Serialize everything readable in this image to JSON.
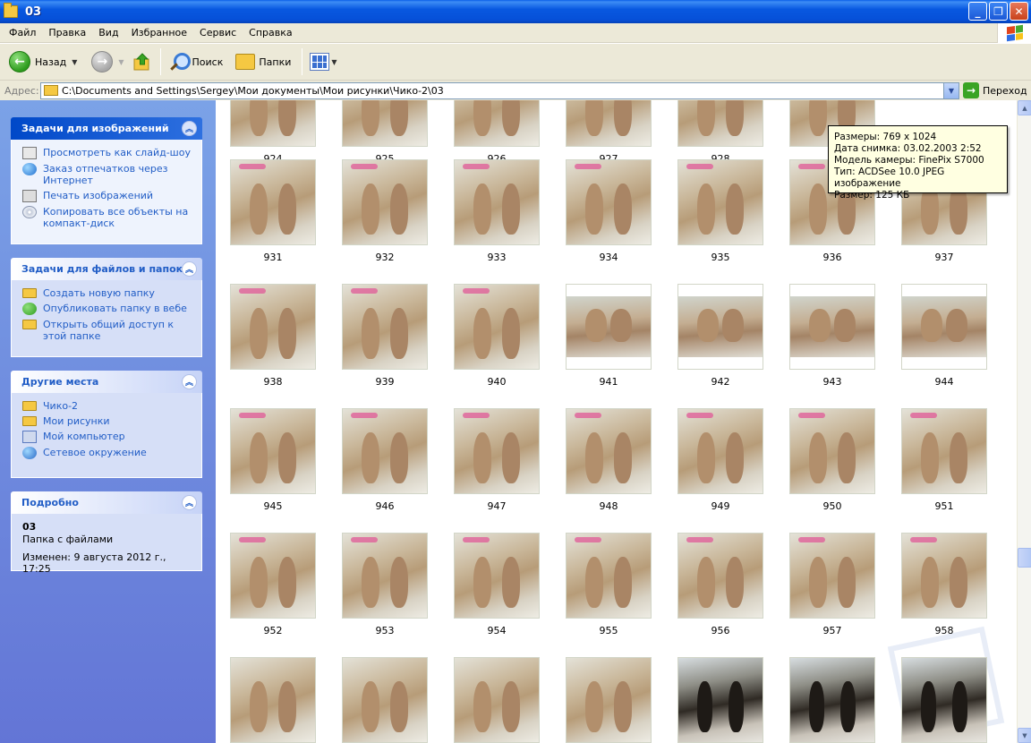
{
  "window": {
    "title": "03"
  },
  "menu": [
    "Файл",
    "Правка",
    "Вид",
    "Избранное",
    "Сервис",
    "Справка"
  ],
  "toolbar": {
    "back": "Назад",
    "search": "Поиск",
    "folders": "Папки"
  },
  "address": {
    "label": "Адрес:",
    "path": "C:\\Documents and Settings\\Sergey\\Мои документы\\Мои рисунки\\Чико-2\\03",
    "go": "Переход"
  },
  "panels": {
    "image_tasks": {
      "title": "Задачи для изображений",
      "items": [
        "Просмотреть как слайд-шоу",
        "Заказ отпечатков через Интернет",
        "Печать изображений",
        "Копировать все объекты на компакт-диск"
      ]
    },
    "file_tasks": {
      "title": "Задачи для файлов и папок",
      "items": [
        "Создать новую папку",
        "Опубликовать папку в вебе",
        "Открыть общий доступ к этой папке"
      ]
    },
    "other_places": {
      "title": "Другие места",
      "items": [
        "Чико-2",
        "Мои рисунки",
        "Мой компьютер",
        "Сетевое окружение"
      ]
    },
    "details": {
      "title": "Подробно",
      "name": "03",
      "type": "Папка с файлами",
      "modified": "Изменен: 9 августа 2012 г., 17:25"
    }
  },
  "tooltip": {
    "line1": "Размеры: 769 x 1024",
    "line2": "Дата снимка: 03.02.2003 2:52",
    "line3": "Модель камеры: FinePix S7000",
    "line4": "Тип: ACDSee 10.0 JPEG изображение",
    "line5": "Размер: 125 КБ"
  },
  "rows": [
    [
      "924",
      "925",
      "926",
      "927",
      "928",
      "9",
      ""
    ],
    [
      "931",
      "932",
      "933",
      "934",
      "935",
      "936",
      "937"
    ],
    [
      "938",
      "939",
      "940",
      "941",
      "942",
      "943",
      "944"
    ],
    [
      "945",
      "946",
      "947",
      "948",
      "949",
      "950",
      "951"
    ],
    [
      "952",
      "953",
      "954",
      "955",
      "956",
      "957",
      "958"
    ]
  ]
}
